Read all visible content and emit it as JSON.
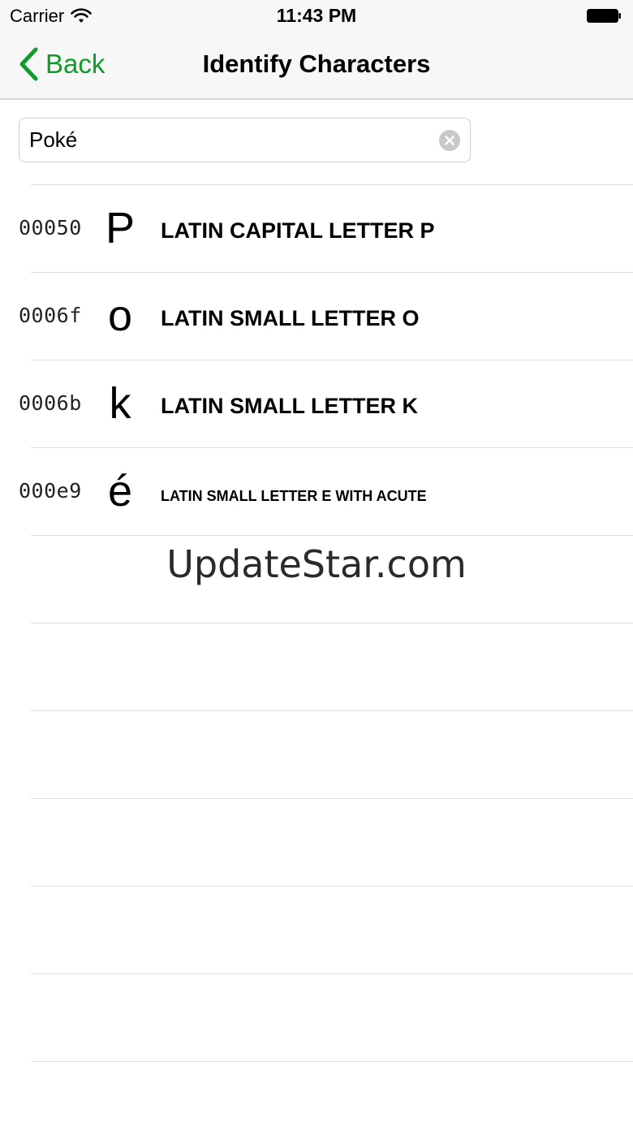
{
  "status_bar": {
    "carrier": "Carrier",
    "time": "11:43 PM",
    "icons": [
      "wifi-icon",
      "battery-icon"
    ]
  },
  "nav": {
    "back_label": "Back",
    "title": "Identify Characters",
    "accent_color": "#129b2a"
  },
  "search": {
    "value": "Poké",
    "clear_icon": "clear-circle-icon"
  },
  "characters": [
    {
      "code": "00050",
      "glyph": "P",
      "name": "LATIN CAPITAL LETTER P"
    },
    {
      "code": "0006f",
      "glyph": "o",
      "name": "LATIN SMALL LETTER O"
    },
    {
      "code": "0006b",
      "glyph": "k",
      "name": "LATIN SMALL LETTER K"
    },
    {
      "code": "000e9",
      "glyph": "é",
      "name": "LATIN SMALL LETTER E WITH ACUTE"
    }
  ],
  "watermark": "UpdateStar.com"
}
